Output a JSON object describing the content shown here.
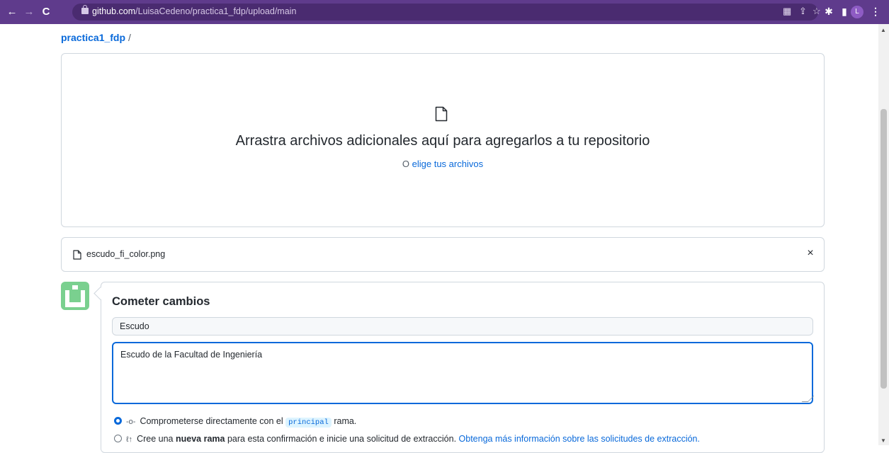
{
  "browser": {
    "url_host": "github.com",
    "url_path": "/LuisaCedeno/practica1_fdp/upload/main",
    "profile_initial": "L"
  },
  "breadcrumb": {
    "repo": "practica1_fdp",
    "separator": "/"
  },
  "dropzone": {
    "title": "Arrastra archivos adicionales aquí para agregarlos a tu repositorio",
    "prefix": "O",
    "choose_link": "elige tus archivos"
  },
  "file": {
    "name": "escudo_fi_color.png",
    "remove_label": "×"
  },
  "commit": {
    "heading": "Cometer cambios",
    "summary_value": "Escudo",
    "description_value": "Escudo de la Facultad de Ingeniería",
    "option_direct": {
      "text_before": "Comprometerse directamente con el",
      "branch": "principal",
      "text_after": "rama.",
      "selected": true
    },
    "option_new_branch": {
      "text_before": "Cree una",
      "bold": "nueva rama",
      "text_after": "para esta confirmación e inicie una solicitud de extracción.",
      "link": "Obtenga más información sobre las solicitudes de extracción.",
      "selected": false
    }
  },
  "colors": {
    "browser_bar": "#5f3b8c",
    "link": "#0969da",
    "border": "#d0d7de",
    "avatar_green": "#7ad08f"
  }
}
